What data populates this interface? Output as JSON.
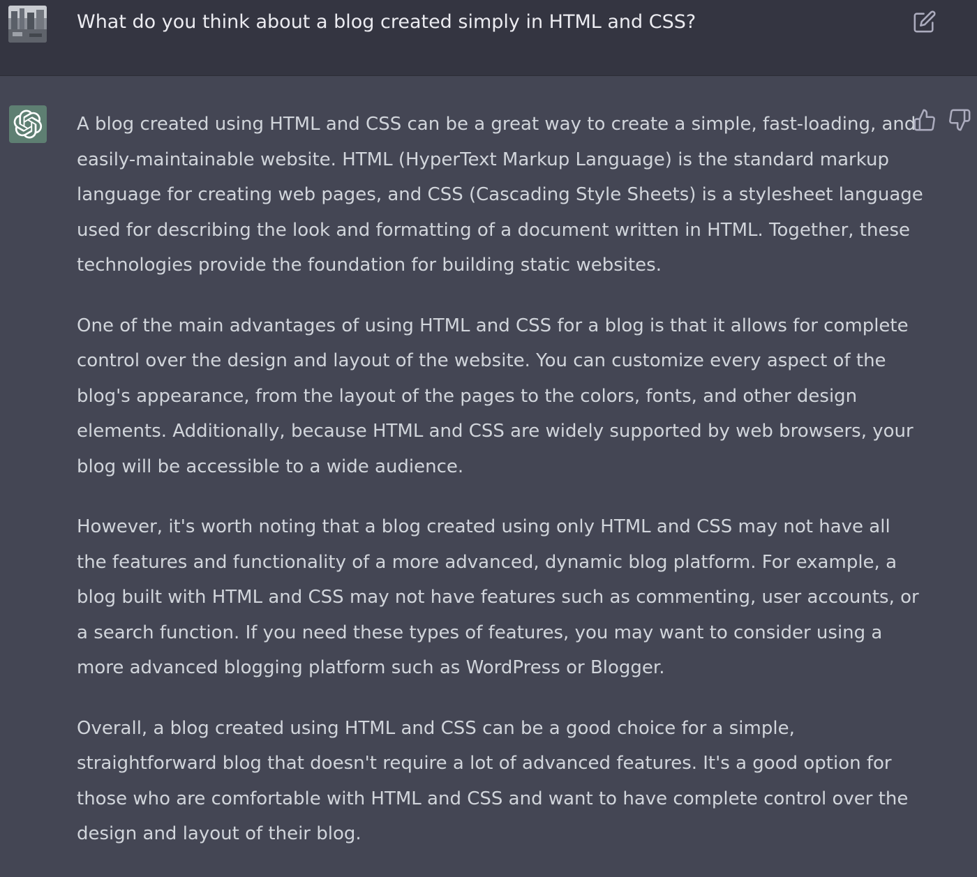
{
  "user_message": {
    "text": "What do you think about a blog created simply in HTML and CSS?",
    "avatar_icon": "user-photo-avatar",
    "edit_icon": "pencil-square-icon"
  },
  "assistant_message": {
    "avatar_icon": "openai-logo-icon",
    "avatar_color": "#5e7f72",
    "feedback_icons": [
      "thumbs-up-icon",
      "thumbs-down-icon"
    ],
    "paragraphs": [
      {
        "lines": [
          "A blog created using HTML and CSS can be a great way to create a simple, fast-loading, and",
          "easily-maintainable website. HTML (HyperText Markup Language) is the standard markup",
          "language for creating web pages, and CSS (Cascading Style Sheets) is a stylesheet language",
          "used for describing the look and formatting of a document written in HTML. Together, these",
          "technologies provide the foundation for building static websites."
        ]
      },
      {
        "lines": [
          "One of the main advantages of using HTML and CSS for a blog is that it allows for complete",
          "control over the design and layout of the website. You can customize every aspect of the",
          "blog's appearance, from the layout of the pages to the colors, fonts, and other design",
          "elements. Additionally, because HTML and CSS are widely supported by web browsers, your",
          "blog will be accessible to a wide audience."
        ]
      },
      {
        "lines": [
          "However, it's worth noting that a blog created using only HTML and CSS may not have all",
          "the features and functionality of a more advanced, dynamic blog platform. For example, a",
          "blog built with HTML and CSS may not have features such as commenting, user accounts, or",
          "a search function. If you need these types of features, you may want to consider using a",
          "more advanced blogging platform such as WordPress or Blogger."
        ]
      },
      {
        "lines": [
          "Overall, a blog created using HTML and CSS can be a good choice for a simple,",
          "straightforward blog that doesn't require a lot of advanced features. It's a good option for",
          "those who are comfortable with HTML and CSS and want to have complete control over the",
          "design and layout of their blog."
        ]
      }
    ]
  },
  "colors": {
    "user_row_bg": "#343541",
    "assistant_row_bg": "#444654",
    "text": "#d1d5db",
    "icon": "#acacbe"
  }
}
